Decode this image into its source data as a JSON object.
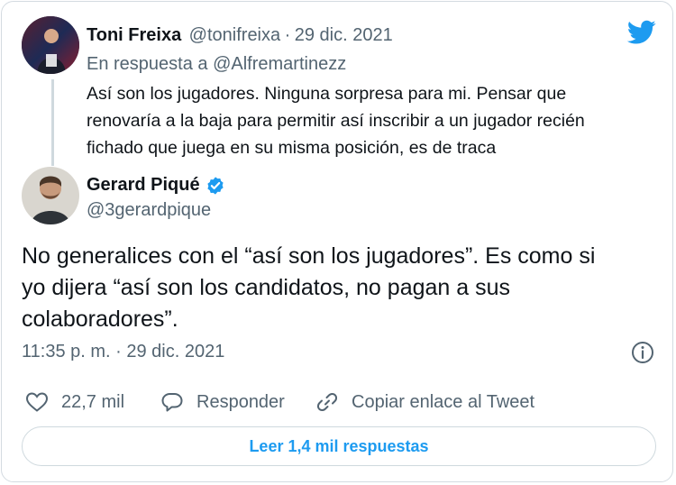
{
  "reply_tweet": {
    "author_name": "Toni Freixa",
    "handle": "@tonifreixa",
    "separator": "·",
    "date": "29 dic. 2021",
    "in_reply_to_prefix": "En respuesta a",
    "in_reply_to_handle": "@Alfremartinezz",
    "lines": [
      "Así son los jugadores. Ninguna sorpresa para mi. Pensar que",
      "renovaría a la baja para permitir así inscribir a un jugador recién",
      "fichado que juega en su misma posición, es de traca"
    ]
  },
  "main_tweet": {
    "author_name": "Gerard Piqué",
    "handle": "@3gerardpique",
    "verified": true,
    "lines": [
      "No generalices con el “así son los jugadores”. Es como si",
      "yo dijera “así son los candidatos, no pagan a sus",
      "colaboradores”."
    ],
    "timestamp": "11:35 p. m. · 29 dic. 2021"
  },
  "actions": {
    "likes": "22,7 mil",
    "reply_label": "Responder",
    "copy_link_label": "Copiar enlace al Tweet"
  },
  "read_replies_label": "Leer 1,4 mil respuestas",
  "colors": {
    "accent": "#1d9bf0",
    "muted": "#536471",
    "border": "#cfd9de"
  },
  "icons": [
    "twitter-bird-icon",
    "verified-badge-icon",
    "info-icon",
    "heart-icon",
    "reply-icon",
    "link-icon"
  ]
}
